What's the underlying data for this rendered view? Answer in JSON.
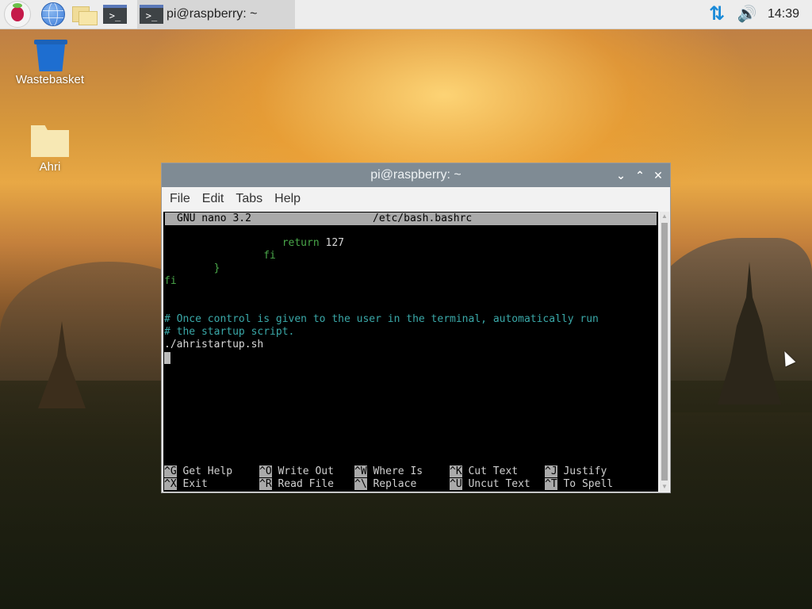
{
  "taskbar": {
    "launchers": [
      {
        "name": "raspberry-menu",
        "icon": "raspberry-icon"
      },
      {
        "name": "web-browser",
        "icon": "globe-icon"
      },
      {
        "name": "file-manager",
        "icon": "folder-icon"
      },
      {
        "name": "terminal",
        "icon": "terminal-icon",
        "glyph": ">_"
      }
    ],
    "task": {
      "label": "pi@raspberry: ~",
      "glyph": ">_"
    },
    "tray": {
      "network_glyph": "⇅",
      "volume_glyph": "🔊",
      "clock": "14:39"
    }
  },
  "desktop": {
    "icons": [
      {
        "label": "Wastebasket",
        "icon": "trash-icon"
      },
      {
        "label": "Ahri",
        "icon": "folder-icon"
      }
    ]
  },
  "window": {
    "title": "pi@raspberry: ~",
    "controls": {
      "minimize": "⌄",
      "maximize": "⌃",
      "close": "✕"
    },
    "menu": [
      "File",
      "Edit",
      "Tabs",
      "Help"
    ],
    "nano": {
      "version": "GNU nano 3.2",
      "filename": "/etc/bash.bashrc",
      "lines": [
        {
          "text": "                   return ",
          "extra": "127",
          "color": "green"
        },
        {
          "text": "                fi",
          "color": "green"
        },
        {
          "text": "        }",
          "color": "green"
        },
        {
          "text": "fi",
          "color": "green"
        },
        {
          "text": "",
          "color": "white"
        },
        {
          "text": "",
          "color": "white"
        },
        {
          "text": "# Once control is given to the user in the terminal, automatically run",
          "color": "cyan"
        },
        {
          "text": "# the startup script.",
          "color": "cyan"
        },
        {
          "text": "./ahristartup.sh",
          "color": "white"
        }
      ],
      "shortcuts": [
        [
          {
            "key": "^G",
            "label": "Get Help"
          },
          {
            "key": "^O",
            "label": "Write Out"
          },
          {
            "key": "^W",
            "label": "Where Is"
          },
          {
            "key": "^K",
            "label": "Cut Text"
          },
          {
            "key": "^J",
            "label": "Justify"
          }
        ],
        [
          {
            "key": "^X",
            "label": "Exit"
          },
          {
            "key": "^R",
            "label": "Read File"
          },
          {
            "key": "^\\",
            "label": "Replace"
          },
          {
            "key": "^U",
            "label": "Uncut Text"
          },
          {
            "key": "^T",
            "label": "To Spell"
          }
        ]
      ]
    }
  }
}
